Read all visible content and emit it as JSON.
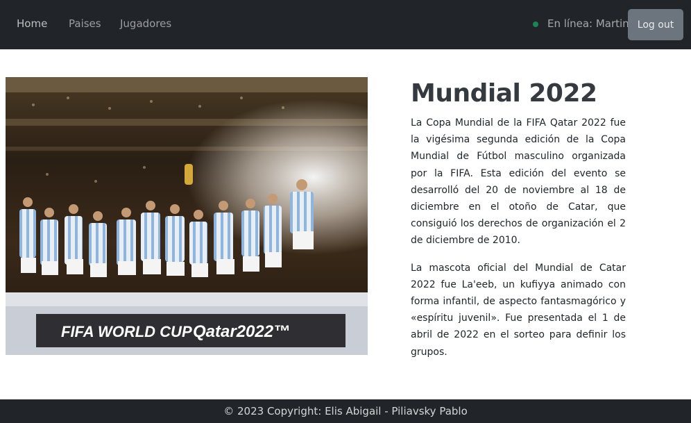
{
  "nav": {
    "links": [
      "Home",
      "Paises",
      "Jugadores"
    ],
    "online_label": "En línea: Martin",
    "logout_label": "Log out",
    "status_color": "#198754"
  },
  "hero": {
    "image_description_icon": "trophy-celebration-photo",
    "banner_text": "FIFA WORLD CUP Qatar2022™"
  },
  "article": {
    "title": "Mundial 2022",
    "paragraphs": [
      "La Copa Mundial de la FIFA Qatar 2022 fue la vigésima segunda edición de la Copa Mundial de Fútbol masculino organizada por la FIFA. Esta edición del evento se desarrolló del 20 de noviembre al 18 de diciembre en el otoño de Catar, que consiguió los derechos de organización el 2 de diciembre de 2010.",
      "La mascota oficial del Mundial de Catar 2022 fue La'eeb, un kufiyya animado con forma infantil, de aspecto fantasmagórico y «espíritu juvenil». Fue presentada el 1 de abril de 2022 en el sorteo para definir los grupos."
    ]
  },
  "footer": {
    "text": "© 2023 Copyright: Elis Abigail - Piliavsky Pablo"
  }
}
